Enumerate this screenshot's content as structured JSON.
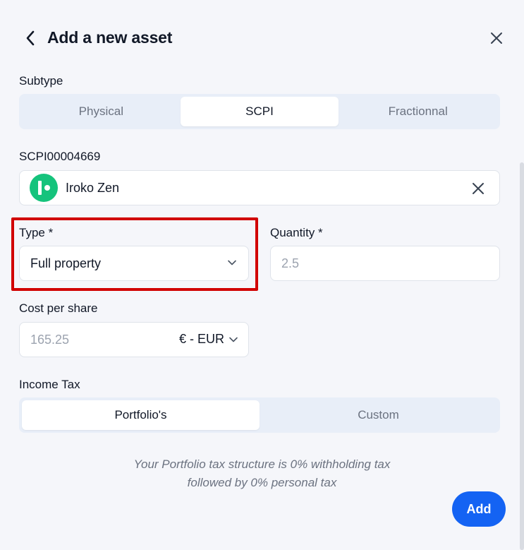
{
  "header": {
    "title": "Add a new asset"
  },
  "subtype": {
    "label": "Subtype",
    "options": [
      "Physical",
      "SCPI",
      "Fractionnal"
    ],
    "selected": "SCPI"
  },
  "asset": {
    "code_label": "SCPI00004669",
    "name": "Iroko Zen",
    "logo_color": "#15c37c"
  },
  "type": {
    "label": "Type *",
    "value": "Full property"
  },
  "quantity": {
    "label": "Quantity *",
    "placeholder": "2.5"
  },
  "cost": {
    "label": "Cost per share",
    "placeholder": "165.25",
    "currency": "€ - EUR"
  },
  "income_tax": {
    "label": "Income Tax",
    "options": [
      "Portfolio's",
      "Custom"
    ],
    "selected": "Portfolio's",
    "note_line1": "Your Portfolio tax structure is 0% withholding tax",
    "note_line2": "followed by 0% personal tax"
  },
  "actions": {
    "add_label": "Add"
  },
  "colors": {
    "accent": "#1463f3",
    "highlight": "#d10000"
  }
}
